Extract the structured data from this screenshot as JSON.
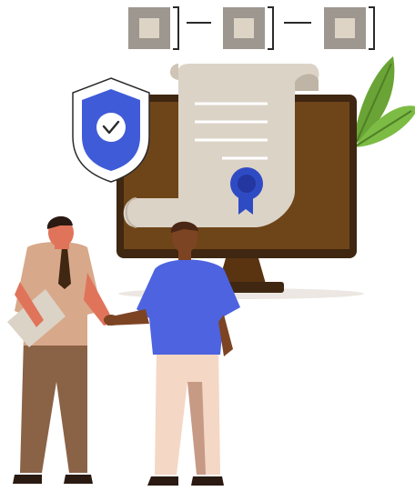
{
  "illustration": {
    "theme": "certified-agreement-handshake",
    "icons": [
      "block-icon",
      "block-icon",
      "block-icon",
      "shield-check-icon",
      "certificate-scroll-icon",
      "award-ribbon-icon",
      "leaf-icon"
    ],
    "colors": {
      "monitor_bezel": "#3f2712",
      "monitor_screen": "#6e4519",
      "monitor_stand": "#5a3310",
      "scroll_paper": "#dcd3c7",
      "shield_blue": "#3f5bd8",
      "badge_blue": "#2f4bc4",
      "leaf_green": "#6aa436",
      "block_gray": "#9d9790",
      "block_center": "#ddd4c6",
      "shirt_blue": "#4e63e0",
      "shirt_beige": "#d8a88a",
      "pants_brown": "#8a6246",
      "pants_cream": "#f4d7c4",
      "skin_dark": "#7d4424",
      "skin_tan": "#e0745a",
      "hair_dark": "#2a1a12"
    }
  }
}
